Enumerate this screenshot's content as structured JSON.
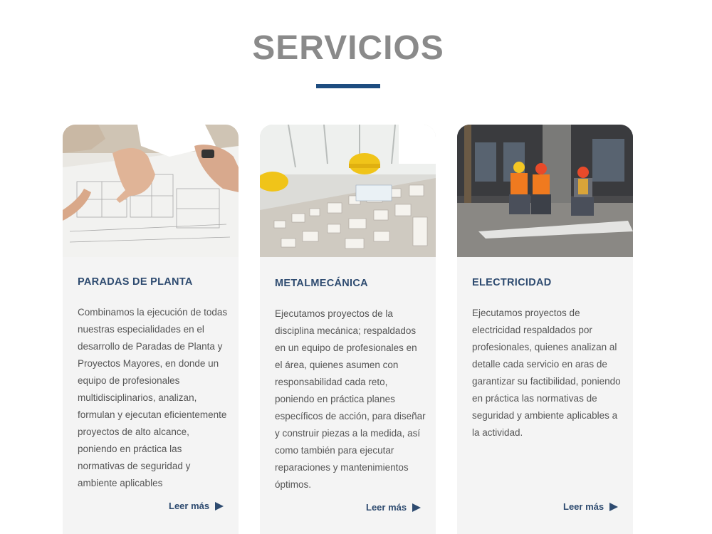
{
  "section": {
    "title": "SERVICIOS",
    "accent_color": "#1e4d80"
  },
  "cards": [
    {
      "title": "PARADAS DE PLANTA",
      "description": "Combinamos la ejecución de todas nuestras especialidades en el desarrollo de Paradas de Planta y Proyectos Mayores, en donde un equipo de profesionales multidisciplinarios, analizan, formulan y ejecutan eficientemente proyectos de alto alcance, poniendo en práctica las normativas de seguridad y ambiente aplicables",
      "read_more": "Leer más",
      "image": "hands-reviewing-blueprints-photo"
    },
    {
      "title": "METALMECÁNICA",
      "description": "Ejecutamos proyectos de la disciplina mecánica; respaldados en un equipo de profesionales en el área, quienes asumen con responsabilidad cada reto, poniendo en práctica planes específicos de acción, para diseñar y construir piezas a la medida, así como también para ejecutar reparaciones y mantenimientos óptimos.",
      "read_more": "Leer más",
      "image": "architectural-model-hard-hats-photo"
    },
    {
      "title": "ELECTRICIDAD",
      "description": "Ejecutamos proyectos de electricidad respaldados por profesionales, quienes analizan al detalle cada servicio en aras de garantizar su factibilidad, poniendo en práctica las normativas de seguridad y ambiente aplicables a la actividad.",
      "read_more": "Leer más",
      "image": "workers-construction-site-photo"
    }
  ]
}
